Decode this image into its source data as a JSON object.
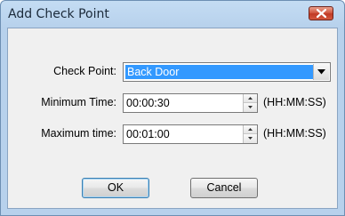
{
  "window": {
    "title": "Add Check Point"
  },
  "form": {
    "checkpoint": {
      "label": "Check Point:",
      "value": "Back Door"
    },
    "min_time": {
      "label": "Minimum Time:",
      "value": "00:00:30",
      "unit": "(HH:MM:SS)"
    },
    "max_time": {
      "label": "Maximum time:",
      "value": "00:01:00",
      "unit": "(HH:MM:SS)"
    }
  },
  "buttons": {
    "ok": "OK",
    "cancel": "Cancel"
  },
  "icons": {
    "close": "close-icon",
    "dropdown": "chevron-down-icon",
    "spin_up": "arrow-up-icon",
    "spin_down": "arrow-down-icon"
  },
  "colors": {
    "selection": "#3399ff",
    "close_button": "#c03a25",
    "title_bar": "#b7d1ec"
  }
}
